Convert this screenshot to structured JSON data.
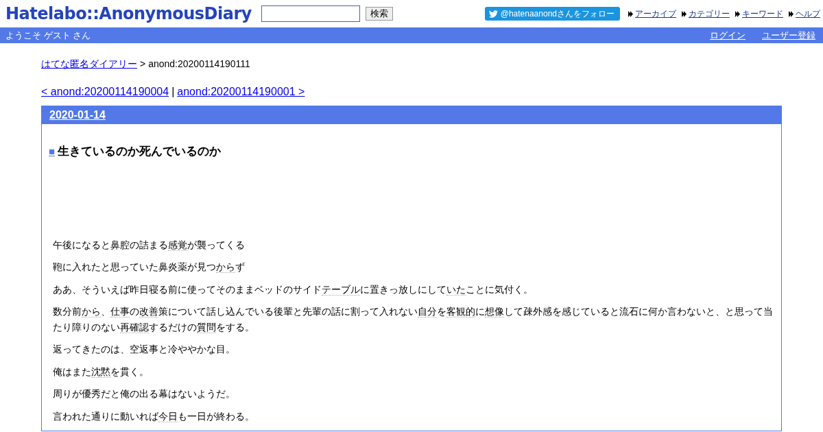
{
  "header": {
    "logo": "Hatelabo::AnonymousDiary",
    "search": {
      "button": "検索"
    },
    "follow_button": "@hatenaanondさんをフォロー",
    "nav_links": [
      "アーカイブ",
      "カテゴリー",
      "キーワード",
      "ヘルプ"
    ]
  },
  "user_bar": {
    "greeting": "ようこそ ゲスト さん",
    "links": [
      "ログイン",
      "ユーザー登録"
    ]
  },
  "breadcrumb": {
    "link": "はてな匿名ダイアリー",
    "separator": ">",
    "current": "anond:20200114190111"
  },
  "pager": {
    "prev": "< anond:20200114190004",
    "separator": "|",
    "next": "anond:20200114190001 >"
  },
  "day": {
    "date": "2020-01-14",
    "entry": {
      "mark": "■",
      "title": "生きているのか死んでいるのか",
      "paragraphs": [
        [
          {
            "text": "午後になると鼻腔の詰まる",
            "keyword": false
          },
          {
            "text": "感覚",
            "keyword": true
          },
          {
            "text": "が襲ってくる",
            "keyword": false
          }
        ],
        [
          {
            "text": "鞄に入れたと思っていた鼻炎薬が見つ",
            "keyword": false
          },
          {
            "text": "から",
            "keyword": true
          },
          {
            "text": "ず",
            "keyword": false
          }
        ],
        [
          {
            "text": "ああ、そういえば昨日寝る前に使ってそのままベッドのサイド",
            "keyword": false
          },
          {
            "text": "テーブル",
            "keyword": true
          },
          {
            "text": "に置きっ放しにして",
            "keyword": false
          },
          {
            "text": "いた",
            "keyword": true
          },
          {
            "text": "ことに気付く。",
            "keyword": false
          }
        ],
        [
          {
            "text": "数分前",
            "keyword": false
          },
          {
            "text": "から",
            "keyword": true
          },
          {
            "text": "、",
            "keyword": false
          },
          {
            "text": "仕事",
            "keyword": true
          },
          {
            "text": "の",
            "keyword": false
          },
          {
            "text": "改善",
            "keyword": true
          },
          {
            "text": "策について話し込んでいる後輩と先輩の話に割って入れない",
            "keyword": false
          },
          {
            "text": "自分",
            "keyword": true
          },
          {
            "text": "を",
            "keyword": false
          },
          {
            "text": "客観的",
            "keyword": true
          },
          {
            "text": "に",
            "keyword": false
          },
          {
            "text": "想像",
            "keyword": true
          },
          {
            "text": "して疎外感を感じていると流石に何か言わないと、と思って当たり障りのない",
            "keyword": false
          },
          {
            "text": "再確認",
            "keyword": true
          },
          {
            "text": "するだけの",
            "keyword": false
          },
          {
            "text": "質問",
            "keyword": true
          },
          {
            "text": "をする。",
            "keyword": false
          }
        ],
        [
          {
            "text": "返ってきたのは、空返事と冷ややかな目。",
            "keyword": false
          }
        ],
        [
          {
            "text": "俺はまた",
            "keyword": false
          },
          {
            "text": "沈黙",
            "keyword": true
          },
          {
            "text": "を貫く。",
            "keyword": false
          }
        ],
        [
          {
            "text": "周りが優秀だと俺の出る幕はないようだ。",
            "keyword": false
          }
        ],
        [
          {
            "text": "言われた通りに動いれば",
            "keyword": false
          },
          {
            "text": "今日",
            "keyword": true
          },
          {
            "text": "も一日が終わる。",
            "keyword": false
          }
        ]
      ]
    }
  }
}
